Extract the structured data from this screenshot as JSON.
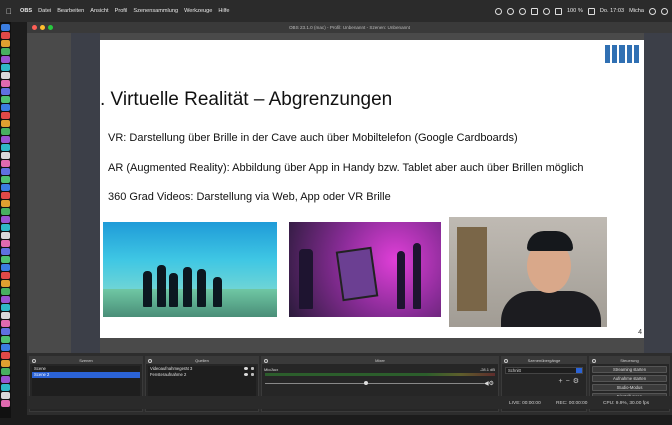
{
  "menubar": {
    "app_name": "OBS",
    "items": [
      "Datei",
      "Bearbeiten",
      "Ansicht",
      "Profil",
      "Szenensammlung",
      "Werkzeuge",
      "Hilfe"
    ],
    "battery": "100 %",
    "clock": "Do. 17:03",
    "user": "Micha"
  },
  "window": {
    "title": "OBS 23.1.0 (mac) - Profil: Unbenannt - Szenen: Unbenannt"
  },
  "slide": {
    "logo": "TUM",
    "title": ". Virtuelle Realität – Abgrenzungen",
    "bullets": [
      "VR: Darstellung über Brille in der Cave auch über Mobiltelefon (Google Cardboards)",
      "AR (Augmented Reality): Abbildung über App in Handy bzw. Tablet aber auch über Brillen möglich",
      "360 Grad Videos: Darstellung via Web, App oder VR Brille"
    ],
    "page_number": "4"
  },
  "scenes": {
    "header": "Szenen",
    "items": [
      "Scene",
      "Scene 2"
    ],
    "selected_index": 1
  },
  "sources": {
    "header": "Quellen",
    "items": [
      "Videoaufnahmegerät 3",
      "Fensteraufnahme 2"
    ]
  },
  "mixer": {
    "header": "Mixer",
    "channel": "Mic/Aux",
    "db": "-28.1 dB"
  },
  "transitions": {
    "header": "Szenenübergänge",
    "selected": "Schnitt"
  },
  "controls": {
    "header": "Steuerung",
    "buttons": [
      "Streaming starten",
      "Aufnahme starten",
      "Studio-Modus",
      "Einstellungen",
      "Beenden"
    ]
  },
  "status": {
    "live": "LIVE: 00:00:00",
    "rec": "REC: 00:00:00",
    "cpu": "CPU: 9.9%, 30.00 fps"
  },
  "colors": {
    "tum_blue": "#3070b3",
    "selection": "#2b63d6"
  }
}
